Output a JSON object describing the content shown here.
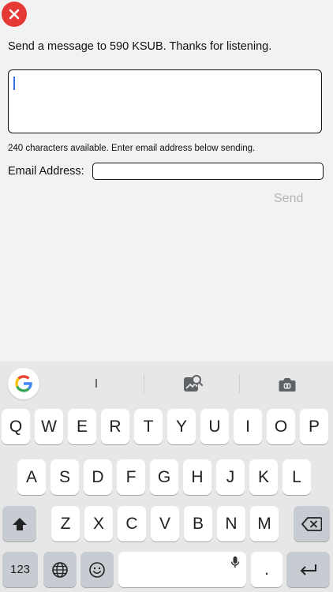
{
  "header": {
    "close_icon": "close-x-icon",
    "close_color": "#e53935"
  },
  "form": {
    "prompt": "Send a message to 590 KSUB. Thanks for listening.",
    "message_value": "",
    "char_info": "240 characters available. Enter email address below sending.",
    "email_label": "Email Address:",
    "email_value": "",
    "send_label": "Send"
  },
  "keyboard": {
    "suggestion": "I",
    "row1": [
      "Q",
      "W",
      "E",
      "R",
      "T",
      "Y",
      "U",
      "I",
      "O",
      "P"
    ],
    "row2": [
      "A",
      "S",
      "D",
      "F",
      "G",
      "H",
      "J",
      "K",
      "L"
    ],
    "row3": [
      "Z",
      "X",
      "C",
      "V",
      "B",
      "N",
      "M"
    ],
    "numbers_label": "123",
    "period_label": ".",
    "icons": {
      "google": "google-g-icon",
      "sticker": "sticker-search-icon",
      "camera": "camera-icon",
      "shift": "shift-arrow-icon",
      "backspace": "backspace-icon",
      "globe": "globe-icon",
      "emoji": "emoji-icon",
      "mic": "microphone-icon",
      "return": "return-arrow-icon"
    }
  }
}
